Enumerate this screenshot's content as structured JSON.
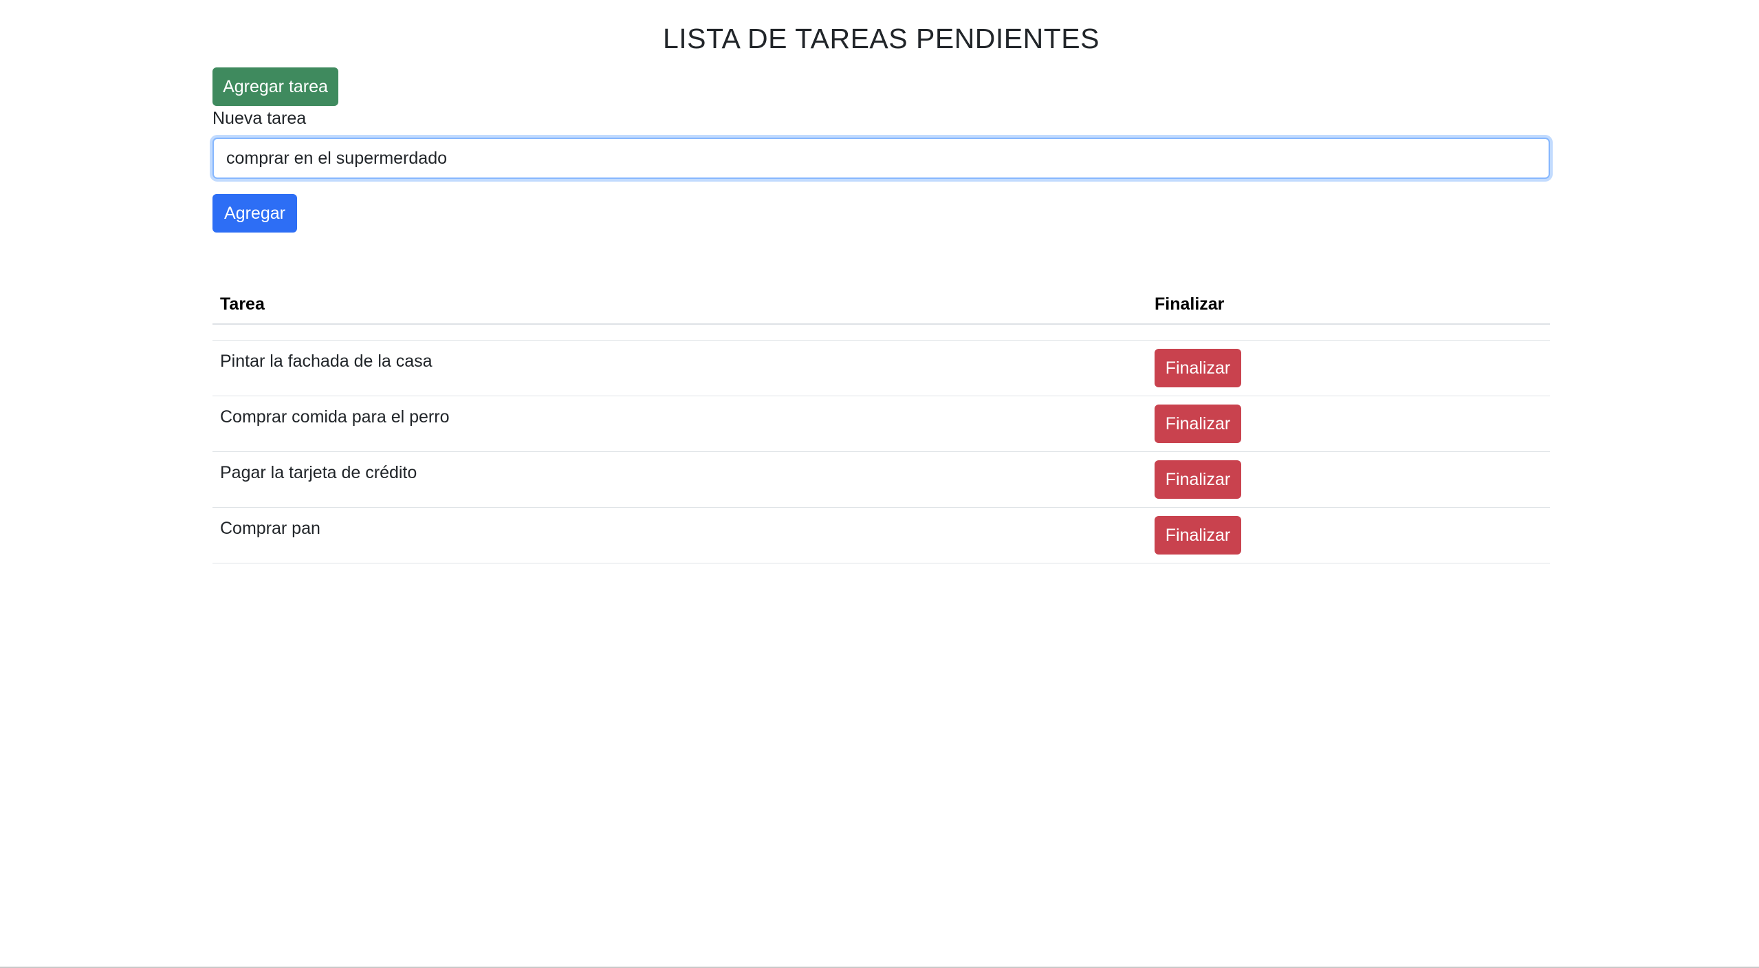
{
  "header": {
    "title": "LISTA DE TAREAS PENDIENTES"
  },
  "toolbar": {
    "add_task_label": "Agregar tarea"
  },
  "form": {
    "label": "Nueva tarea",
    "input_value": "comprar en el supermerdado",
    "submit_label": "Agregar"
  },
  "table": {
    "columns": [
      "Tarea",
      "Finalizar"
    ],
    "rows": [
      {
        "task": "Pintar la fachada de la casa",
        "action": "Finalizar"
      },
      {
        "task": "Comprar comida para el perro",
        "action": "Finalizar"
      },
      {
        "task": "Pagar la tarjeta de crédito",
        "action": "Finalizar"
      },
      {
        "task": "Comprar pan",
        "action": "Finalizar"
      }
    ]
  },
  "colors": {
    "success": "#3f8a5e",
    "primary": "#2d6ef5",
    "danger": "#c9424e",
    "focus_border": "#86b7fe"
  }
}
